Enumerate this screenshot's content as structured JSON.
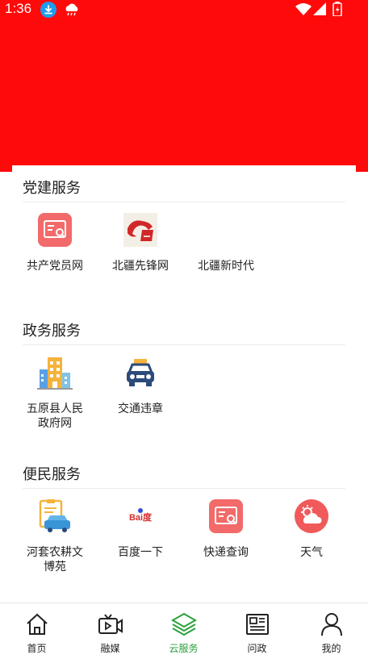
{
  "status_bar": {
    "time": "1:36",
    "icons": [
      "download-icon",
      "weather-icon",
      "wifi-icon",
      "signal-icon",
      "battery-icon"
    ]
  },
  "colors": {
    "header_red": "#ff0a0a",
    "active_tab_green": "#2aa03a"
  },
  "sections": [
    {
      "title": "党建服务",
      "items": [
        {
          "label": "共产党员网",
          "icon": "document-search-icon"
        },
        {
          "label": "北疆先锋网",
          "icon": "beijiang-horse-logo-icon"
        },
        {
          "label": "北疆新时代",
          "icon": ""
        }
      ]
    },
    {
      "title": "政务服务",
      "items": [
        {
          "label": "五原县人民政府网",
          "icon": "government-buildings-icon"
        },
        {
          "label": "交通违章",
          "icon": "taxi-car-icon"
        }
      ]
    },
    {
      "title": "便民服务",
      "items": [
        {
          "label": "河套农耕文博苑",
          "icon": "car-clipboard-icon"
        },
        {
          "label": "百度一下",
          "icon": "baidu-logo-icon"
        },
        {
          "label": "快递查询",
          "icon": "document-search-icon"
        },
        {
          "label": "天气",
          "icon": "weather-sun-cloud-icon"
        }
      ]
    }
  ],
  "baidu_logo_text": "Bai度",
  "tabs": [
    {
      "label": "首页",
      "icon": "home-icon",
      "active": false
    },
    {
      "label": "融媒",
      "icon": "video-icon",
      "active": false
    },
    {
      "label": "云服务",
      "icon": "layers-icon",
      "active": true
    },
    {
      "label": "问政",
      "icon": "newspaper-icon",
      "active": false
    },
    {
      "label": "我的",
      "icon": "user-icon",
      "active": false
    }
  ]
}
